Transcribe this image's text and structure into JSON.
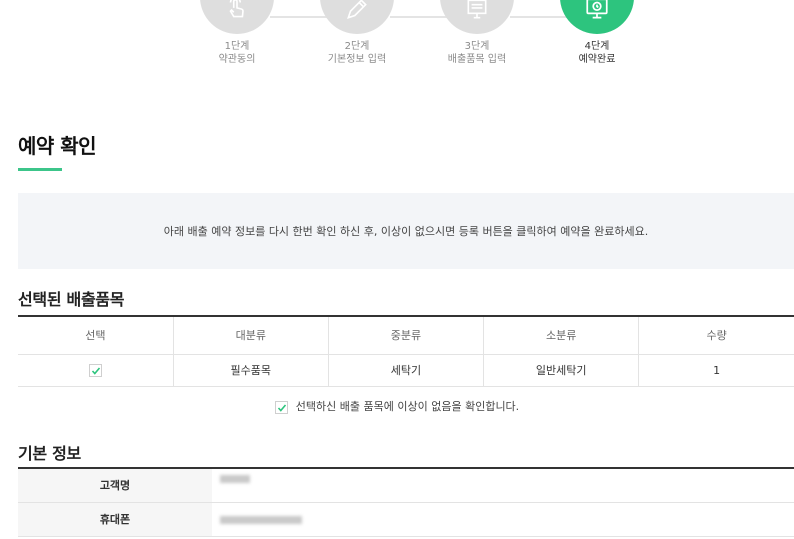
{
  "steps": [
    {
      "num": "1단계",
      "label": "약관동의",
      "icon": "hand-tap-icon",
      "active": false
    },
    {
      "num": "2단계",
      "label": "기본정보 입력",
      "icon": "pencil-icon",
      "active": false
    },
    {
      "num": "3단계",
      "label": "배출품목 입력",
      "icon": "document-icon",
      "active": false
    },
    {
      "num": "4단계",
      "label": "예약완료",
      "icon": "monitor-clock-icon",
      "active": true
    }
  ],
  "page_title": "예약 확인",
  "notice": "아래 배출 예약 정보를 다시 한번 확인 하신 후, 이상이 없으시면 등록 버튼을 클릭하여 예약을 완료하세요.",
  "items_section": {
    "title": "선택된 배출품목",
    "columns": [
      "선택",
      "대분류",
      "중분류",
      "소분류",
      "수량"
    ],
    "rows": [
      {
        "checked": true,
        "major": "필수품목",
        "middle": "세탁기",
        "minor": "일반세탁기",
        "qty": "1"
      }
    ],
    "confirm_text": "선택하신 배출 품목에 이상이 없음을 확인합니다."
  },
  "info_section": {
    "title": "기본 정보",
    "fields": [
      {
        "label": "고객명",
        "value": ""
      },
      {
        "label": "휴대폰",
        "value": ""
      }
    ]
  },
  "colors": {
    "accent": "#2dc47e",
    "inactive_step": "#dedede",
    "notice_bg": "#f3f5f8"
  }
}
